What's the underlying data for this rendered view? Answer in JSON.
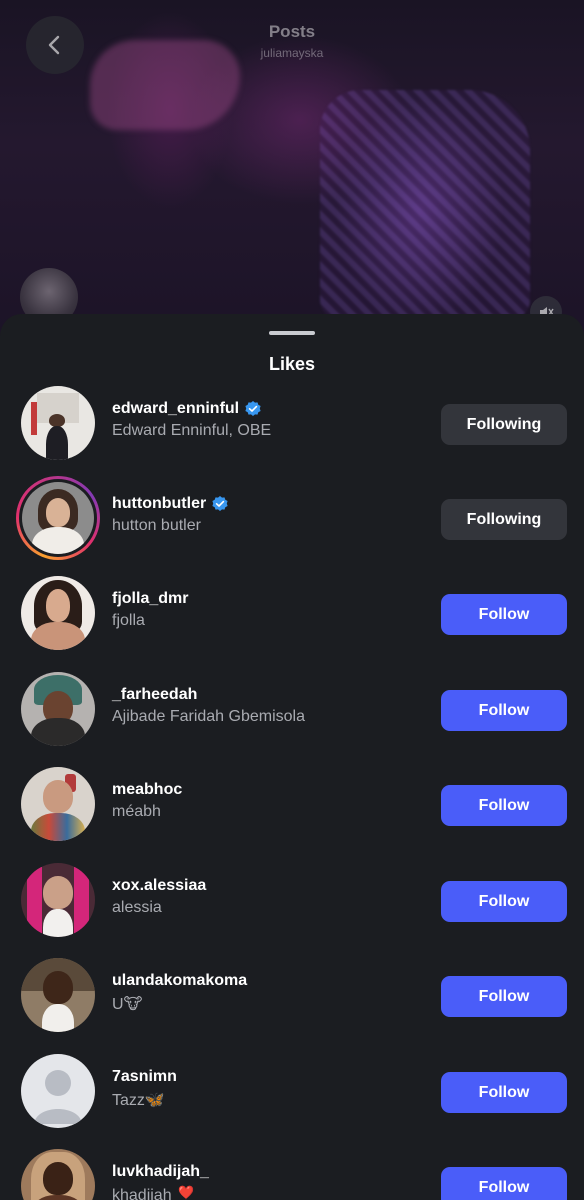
{
  "header": {
    "title": "Posts",
    "subtitle": "juliamayska"
  },
  "sheet": {
    "title": "Likes"
  },
  "users": [
    {
      "username": "edward_enninful",
      "full_name": "Edward Enninful, OBE",
      "verified": true,
      "story": false,
      "button": "Following",
      "state": "following"
    },
    {
      "username": "huttonbutler",
      "full_name": "hutton butler",
      "verified": true,
      "story": true,
      "button": "Following",
      "state": "following"
    },
    {
      "username": "fjolla_dmr",
      "full_name": "fjolla",
      "verified": false,
      "story": false,
      "button": "Follow",
      "state": "follow"
    },
    {
      "username": "_farheedah",
      "full_name": "Ajibade Faridah Gbemisola",
      "verified": false,
      "story": false,
      "button": "Follow",
      "state": "follow"
    },
    {
      "username": "meabhoc",
      "full_name": "méabh",
      "verified": false,
      "story": false,
      "button": "Follow",
      "state": "follow"
    },
    {
      "username": "xox.alessiaa",
      "full_name": "alessia",
      "verified": false,
      "story": false,
      "button": "Follow",
      "state": "follow"
    },
    {
      "username": "ulandakomakoma",
      "full_name": "U🐮",
      "verified": false,
      "story": false,
      "button": "Follow",
      "state": "follow"
    },
    {
      "username": "7asnimn",
      "full_name": "Tazz🦋",
      "verified": false,
      "story": false,
      "button": "Follow",
      "state": "follow"
    },
    {
      "username": "luvkhadijah_",
      "full_name": "khadijah ❣️",
      "verified": false,
      "story": false,
      "button": "Follow",
      "state": "follow"
    }
  ],
  "colors": {
    "follow_button": "#4a5df9",
    "following_button": "#33353b",
    "verified_badge": "#3897f0",
    "sheet_background": "#1b1d21"
  },
  "icons": {
    "back": "chevron-left-icon",
    "mute": "speaker-muted-icon",
    "verified": "verified-badge-icon"
  }
}
